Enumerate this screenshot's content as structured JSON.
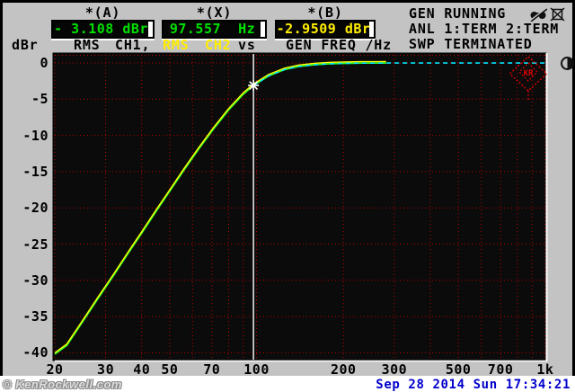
{
  "colors": {
    "readout_green": "#00e000",
    "readout_yellow": "#ffee00",
    "grid_red": "#b80000",
    "trace_ch1_green": "#2aff2a",
    "trace_ch2_yellow": "#ffff00",
    "cursor_trace_cyan": "#00e8ff",
    "date_blue": "#0000cc",
    "plot_background": "#0b0b0b",
    "bezel_gray": "#c3c3c3"
  },
  "header": {
    "readouts": [
      {
        "label": "*(A)",
        "value": "- 3.108 dBr"
      },
      {
        "label": "*(X)",
        "value": "97.557  Hz"
      },
      {
        "label": "*(B)",
        "value": "-2.9509 dBr"
      }
    ],
    "y_unit_label": "dBr",
    "trace1_rms": "RMS",
    "trace1_ch": "CH1,",
    "trace2_rms": "RMS",
    "trace2_ch": "CH2",
    "versus": "vs",
    "x_axis_label": "GEN FREQ /Hz",
    "status": [
      "GEN RUNNING",
      "ANL 1:TERM 2:TERM",
      "SWP TERMINATED"
    ]
  },
  "plot": {
    "corner_mark": "KR"
  },
  "footer": {
    "watermark": "© KenRockwell.com",
    "datetime": "Sep 28 2014 Sun 17:34:21"
  },
  "chart_data": {
    "type": "line",
    "title": "",
    "xlabel": "GEN FREQ /Hz",
    "ylabel": "dBr",
    "x_scale": "log",
    "xlim": [
      20,
      1000
    ],
    "ylim": [
      -40,
      0
    ],
    "grid": "red-dotted",
    "x_gridlines_hz": [
      20,
      30,
      40,
      50,
      60,
      70,
      80,
      90,
      100,
      200,
      300,
      400,
      500,
      600,
      700,
      800,
      900,
      1000
    ],
    "x_ticks": [
      {
        "hz": 20,
        "label": "20"
      },
      {
        "hz": 30,
        "label": "30"
      },
      {
        "hz": 40,
        "label": "40"
      },
      {
        "hz": 50,
        "label": "50"
      },
      {
        "hz": 70,
        "label": "70"
      },
      {
        "hz": 100,
        "label": "100"
      },
      {
        "hz": 200,
        "label": "200"
      },
      {
        "hz": 300,
        "label": "300"
      },
      {
        "hz": 500,
        "label": "500"
      },
      {
        "hz": 700,
        "label": "700"
      },
      {
        "hz": 1000,
        "label": "1k"
      }
    ],
    "y_gridlines_db": [
      0,
      -5,
      -10,
      -15,
      -20,
      -25,
      -30,
      -35,
      -40
    ],
    "y_tick_labels": [
      "0",
      "-5",
      "-10",
      "-15",
      "-20",
      "-25",
      "-30",
      "-35",
      "-40"
    ],
    "cursor": {
      "x_hz": 97.557,
      "a_dbr": -3.108,
      "b_dbr": -2.9509
    },
    "response_points": [
      [
        20,
        -40.2
      ],
      [
        22,
        -39.0
      ],
      [
        25,
        -35.7
      ],
      [
        28,
        -32.7
      ],
      [
        32,
        -29.3
      ],
      [
        36,
        -26.2
      ],
      [
        40,
        -23.5
      ],
      [
        45,
        -20.4
      ],
      [
        50,
        -17.7
      ],
      [
        56,
        -14.8
      ],
      [
        63,
        -11.9
      ],
      [
        71,
        -9.1
      ],
      [
        80,
        -6.5
      ],
      [
        90,
        -4.3
      ],
      [
        97.56,
        -3.11
      ],
      [
        110,
        -1.8
      ],
      [
        125,
        -0.92
      ],
      [
        140,
        -0.49
      ],
      [
        160,
        -0.23
      ],
      [
        180,
        -0.11
      ],
      [
        200,
        -0.06
      ],
      [
        230,
        -0.03
      ],
      [
        260,
        -0.02
      ],
      [
        281,
        -0.01
      ]
    ],
    "series": [
      {
        "name": "RMS CH1",
        "color": "#2aff2a",
        "width": 1.7,
        "dash": null,
        "use": "response",
        "y_offset": 0
      },
      {
        "name": "RMS CH2",
        "color": "#ffff00",
        "width": 1.4,
        "dash": null,
        "use": "response",
        "y_offset": -1.6
      },
      {
        "name": "cursor sweep trace",
        "color": "#00e8ff",
        "width": 1.6,
        "dash": "5 4",
        "y_offset": 0,
        "points": [
          [
            97.56,
            -3.11
          ],
          [
            110,
            -1.8
          ],
          [
            125,
            -0.92
          ],
          [
            140,
            -0.49
          ],
          [
            160,
            -0.23
          ],
          [
            180,
            -0.11
          ],
          [
            200,
            -0.06
          ],
          [
            230,
            -0.03
          ],
          [
            260,
            -0.02
          ],
          [
            281,
            -0.01
          ],
          [
            400,
            -0.01
          ],
          [
            700,
            -0.01
          ],
          [
            1000,
            -0.01
          ]
        ]
      }
    ]
  }
}
